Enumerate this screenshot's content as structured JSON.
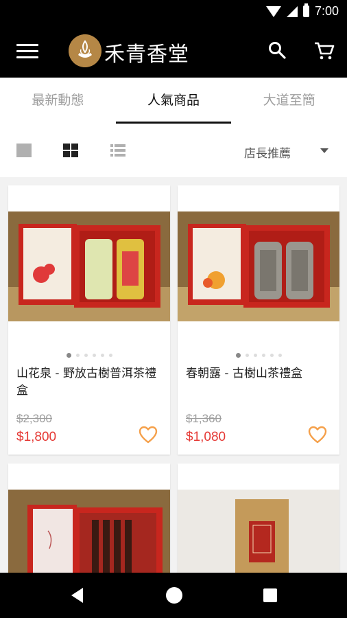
{
  "status_bar": {
    "time": "7:00"
  },
  "app_bar": {
    "brand": "禾青香堂"
  },
  "tabs": [
    {
      "label": "最新動態",
      "active": false
    },
    {
      "label": "人氣商品",
      "active": true
    },
    {
      "label": "大道至簡",
      "active": false
    }
  ],
  "toolbar": {
    "view_modes": [
      "single-view",
      "grid-view",
      "list-view"
    ],
    "active_view": "grid-view",
    "sort_label": "店長推薦"
  },
  "products": [
    {
      "name": "山花泉 - 野放古樹普洱茶禮盒",
      "original_price": "$2,300",
      "price": "$1,800",
      "image_page": 1,
      "image_count": 6
    },
    {
      "name": "春朝露 - 古樹山茶禮盒",
      "original_price": "$1,360",
      "price": "$1,080",
      "image_page": 1,
      "image_count": 6
    },
    {
      "name": "",
      "original_price": "",
      "price": ""
    },
    {
      "name": "",
      "original_price": "",
      "price": ""
    }
  ],
  "colors": {
    "price_red": "#e53935",
    "heart_orange": "#f5a04a",
    "brand_gold": "#b58746",
    "box_red": "#c8261e"
  }
}
